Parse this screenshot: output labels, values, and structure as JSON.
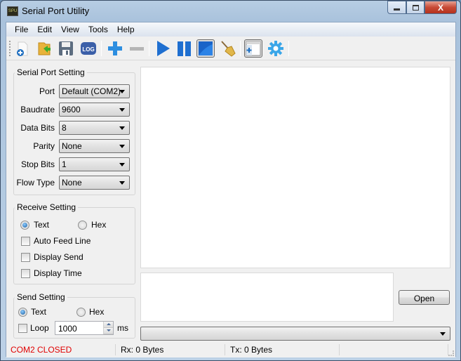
{
  "window": {
    "title": "Serial Port Utility",
    "icon_text": "SPU",
    "controls": {
      "minimize": "‒",
      "maximize": "□",
      "close": "X"
    }
  },
  "menu": [
    "File",
    "Edit",
    "View",
    "Tools",
    "Help"
  ],
  "toolbar": [
    {
      "name": "new-file-icon",
      "active": false
    },
    {
      "name": "open-folder-icon",
      "active": false
    },
    {
      "name": "save-icon",
      "active": false
    },
    {
      "name": "log-icon",
      "active": false,
      "text": "LOG"
    },
    {
      "name": "add-icon",
      "active": false
    },
    {
      "name": "remove-icon",
      "active": false
    },
    {
      "name": "play-icon",
      "active": false
    },
    {
      "name": "pause-icon",
      "active": false
    },
    {
      "name": "stop-icon",
      "active": true
    },
    {
      "name": "clear-broom-icon",
      "active": false
    },
    {
      "name": "layout-window-icon",
      "active": true
    },
    {
      "name": "settings-gear-icon",
      "active": false
    }
  ],
  "serial_port_setting": {
    "title": "Serial Port Setting",
    "fields": [
      {
        "label": "Port",
        "value": "Default (COM2)"
      },
      {
        "label": "Baudrate",
        "value": "9600"
      },
      {
        "label": "Data Bits",
        "value": "8"
      },
      {
        "label": "Parity",
        "value": "None"
      },
      {
        "label": "Stop Bits",
        "value": "1"
      },
      {
        "label": "Flow Type",
        "value": "None"
      }
    ]
  },
  "receive_setting": {
    "title": "Receive Setting",
    "format": {
      "options": [
        "Text",
        "Hex"
      ],
      "selected": "Text"
    },
    "checkboxes": [
      {
        "label": "Auto Feed Line",
        "checked": false
      },
      {
        "label": "Display Send",
        "checked": false
      },
      {
        "label": "Display Time",
        "checked": false
      }
    ]
  },
  "send_setting": {
    "title": "Send Setting",
    "format": {
      "options": [
        "Text",
        "Hex"
      ],
      "selected": "Text"
    },
    "loop": {
      "label": "Loop",
      "checked": false,
      "value": "1000",
      "unit": "ms"
    }
  },
  "receive_area": {
    "content": ""
  },
  "send_area": {
    "content": ""
  },
  "open_button": "Open",
  "history_combo": {
    "value": ""
  },
  "status": {
    "port_state": "COM2 CLOSED",
    "port_state_color": "#e00000",
    "rx": "Rx: 0 Bytes",
    "tx": "Tx: 0 Bytes"
  }
}
